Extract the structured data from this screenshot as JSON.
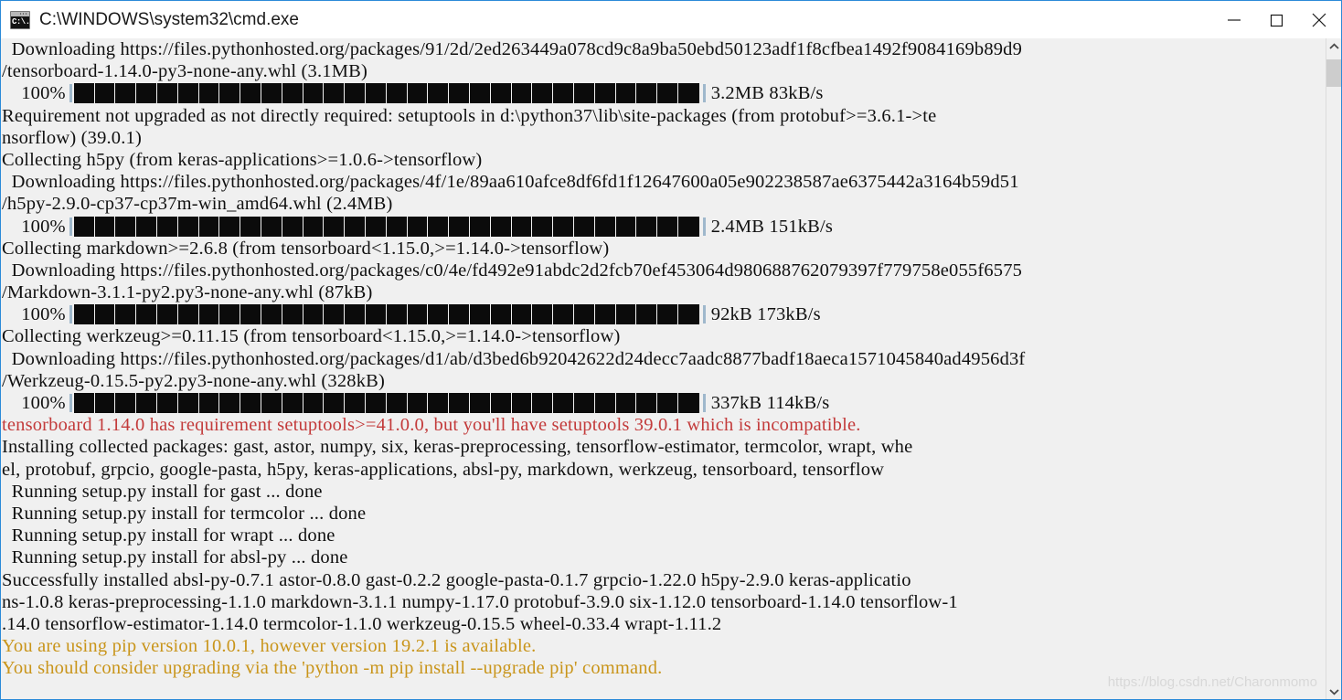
{
  "window": {
    "title": "C:\\WINDOWS\\system32\\cmd.exe",
    "icon": "cmd-icon",
    "icon_glyph": "C:\\.",
    "accent_border": "#2b8ad8",
    "titlebar_bg": "#ffffff",
    "console_bg": "#f0f0f0",
    "text_color": "#101010",
    "error_color": "#c33b3b",
    "warning_color": "#c9951b",
    "controls": {
      "minimize_label": "Minimize",
      "maximize_label": "Maximize",
      "close_label": "Close"
    }
  },
  "scrollbar": {
    "up_arrow": "chevron-up-icon",
    "down_arrow": "chevron-down-icon",
    "thumb_top_pct": 3,
    "thumb_height_pct": 4
  },
  "watermark": {
    "text": "https://blog.csdn.net/Charonmomo"
  },
  "console": {
    "lines": [
      {
        "type": "text",
        "style": "normal",
        "text": "  Downloading https://files.pythonhosted.org/packages/91/2d/2ed263449a078cd9c8a9ba50ebd50123adf1f8cfbea1492f9084169b89d9"
      },
      {
        "type": "text",
        "style": "normal",
        "text": "/tensorboard-1.14.0-py3-none-any.whl (3.1MB)"
      },
      {
        "type": "progress",
        "style": "normal",
        "percent": "    100%",
        "blocks": 30,
        "stats": "3.2MB 83kB/s"
      },
      {
        "type": "text",
        "style": "normal",
        "text": "Requirement not upgraded as not directly required: setuptools in d:\\python37\\lib\\site-packages (from protobuf>=3.6.1->te"
      },
      {
        "type": "text",
        "style": "normal",
        "text": "nsorflow) (39.0.1)"
      },
      {
        "type": "text",
        "style": "normal",
        "text": "Collecting h5py (from keras-applications>=1.0.6->tensorflow)"
      },
      {
        "type": "text",
        "style": "normal",
        "text": "  Downloading https://files.pythonhosted.org/packages/4f/1e/89aa610afce8df6fd1f12647600a05e902238587ae6375442a3164b59d51"
      },
      {
        "type": "text",
        "style": "normal",
        "text": "/h5py-2.9.0-cp37-cp37m-win_amd64.whl (2.4MB)"
      },
      {
        "type": "progress",
        "style": "normal",
        "percent": "    100%",
        "blocks": 30,
        "stats": "2.4MB 151kB/s"
      },
      {
        "type": "text",
        "style": "normal",
        "text": "Collecting markdown>=2.6.8 (from tensorboard<1.15.0,>=1.14.0->tensorflow)"
      },
      {
        "type": "text",
        "style": "normal",
        "text": "  Downloading https://files.pythonhosted.org/packages/c0/4e/fd492e91abdc2d2fcb70ef453064d980688762079397f779758e055f6575"
      },
      {
        "type": "text",
        "style": "normal",
        "text": "/Markdown-3.1.1-py2.py3-none-any.whl (87kB)"
      },
      {
        "type": "progress",
        "style": "normal",
        "percent": "    100%",
        "blocks": 30,
        "stats": "92kB 173kB/s"
      },
      {
        "type": "text",
        "style": "normal",
        "text": "Collecting werkzeug>=0.11.15 (from tensorboard<1.15.0,>=1.14.0->tensorflow)"
      },
      {
        "type": "text",
        "style": "normal",
        "text": "  Downloading https://files.pythonhosted.org/packages/d1/ab/d3bed6b92042622d24decc7aadc8877badf18aeca1571045840ad4956d3f"
      },
      {
        "type": "text",
        "style": "normal",
        "text": "/Werkzeug-0.15.5-py2.py3-none-any.whl (328kB)"
      },
      {
        "type": "progress",
        "style": "normal",
        "percent": "    100%",
        "blocks": 30,
        "stats": "337kB 114kB/s"
      },
      {
        "type": "text",
        "style": "err",
        "text": "tensorboard 1.14.0 has requirement setuptools>=41.0.0, but you'll have setuptools 39.0.1 which is incompatible."
      },
      {
        "type": "text",
        "style": "normal",
        "text": "Installing collected packages: gast, astor, numpy, six, keras-preprocessing, tensorflow-estimator, termcolor, wrapt, whe"
      },
      {
        "type": "text",
        "style": "normal",
        "text": "el, protobuf, grpcio, google-pasta, h5py, keras-applications, absl-py, markdown, werkzeug, tensorboard, tensorflow"
      },
      {
        "type": "text",
        "style": "normal",
        "text": "  Running setup.py install for gast ... done"
      },
      {
        "type": "text",
        "style": "normal",
        "text": "  Running setup.py install for termcolor ... done"
      },
      {
        "type": "text",
        "style": "normal",
        "text": "  Running setup.py install for wrapt ... done"
      },
      {
        "type": "text",
        "style": "normal",
        "text": "  Running setup.py install for absl-py ... done"
      },
      {
        "type": "text",
        "style": "normal",
        "text": "Successfully installed absl-py-0.7.1 astor-0.8.0 gast-0.2.2 google-pasta-0.1.7 grpcio-1.22.0 h5py-2.9.0 keras-applicatio"
      },
      {
        "type": "text",
        "style": "normal",
        "text": "ns-1.0.8 keras-preprocessing-1.1.0 markdown-3.1.1 numpy-1.17.0 protobuf-3.9.0 six-1.12.0 tensorboard-1.14.0 tensorflow-1"
      },
      {
        "type": "text",
        "style": "normal",
        "text": ".14.0 tensorflow-estimator-1.14.0 termcolor-1.1.0 werkzeug-0.15.5 wheel-0.33.4 wrapt-1.11.2"
      },
      {
        "type": "text",
        "style": "warn",
        "text": "You are using pip version 10.0.1, however version 19.2.1 is available."
      },
      {
        "type": "text",
        "style": "warn",
        "text": "You should consider upgrading via the 'python -m pip install --upgrade pip' command."
      }
    ]
  }
}
